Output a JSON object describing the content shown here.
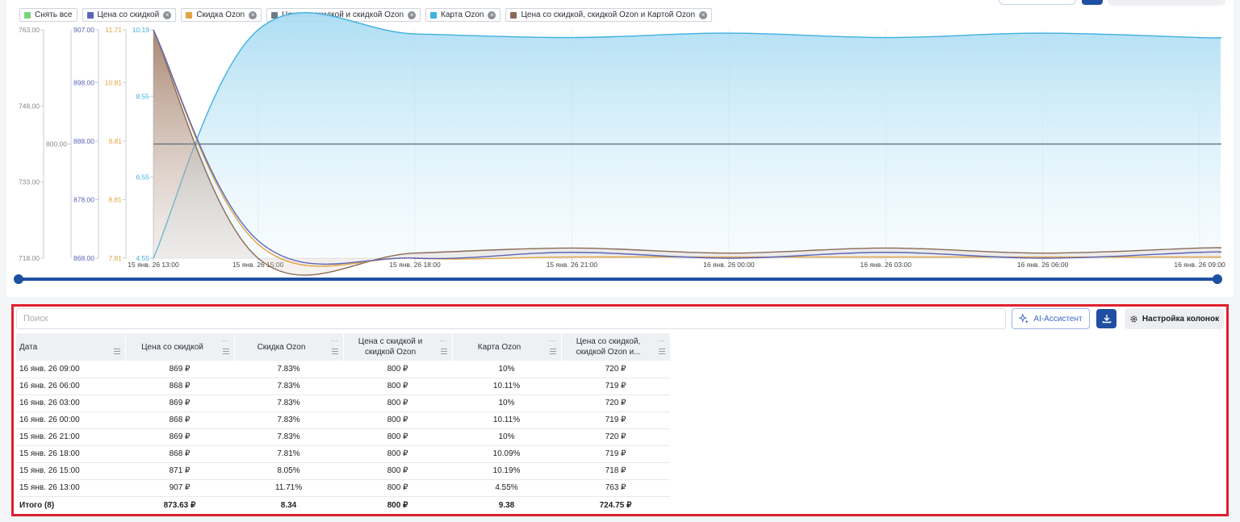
{
  "legend": [
    {
      "label": "Снять все",
      "color": "#7ad37a",
      "closable": false
    },
    {
      "label": "Цена со скидкой",
      "color": "#5b64b8",
      "closable": true
    },
    {
      "label": "Скидка Ozon",
      "color": "#e2a341",
      "closable": true
    },
    {
      "label": "Цена со скидкой и скидкой Ozon",
      "color": "#6d7b84",
      "closable": true
    },
    {
      "label": "Карта Ozon",
      "color": "#3fb0e0",
      "closable": true
    },
    {
      "label": "Цена со скидкой, скидкой Ozon и Картой Ozon",
      "color": "#8a6a58",
      "closable": true
    }
  ],
  "chart_data": {
    "type": "line",
    "x": [
      "15 янв. 26 13:00",
      "15 янв. 26 15:00",
      "15 янв. 26 18:00",
      "15 янв. 26 21:00",
      "16 янв. 26 00:00",
      "16 янв. 26 03:00",
      "16 янв. 26 06:00",
      "16 янв. 26 09:00"
    ],
    "x_tick_labels": [
      "15 янв. 26 13:00",
      "15 янв. 26 15:00",
      "15 янв. 26 18:00",
      "15 янв. 26 21:00",
      "16 янв. 26 00:00",
      "16 янв. 26 03:00",
      "16 янв. 26 06:00",
      "16 янв. 26 09:00"
    ],
    "x_tick_hours": [
      0,
      2,
      5,
      8,
      11,
      14,
      17,
      20
    ],
    "axes": [
      {
        "id": "a1",
        "color": "#888",
        "ticks": [
          "763.00",
          "748.00",
          "733.00",
          "718.00"
        ],
        "min": 718,
        "max": 763
      },
      {
        "id": "a2",
        "color": "#888",
        "ticks": [
          "800.00"
        ],
        "min": 800,
        "max": 800
      },
      {
        "id": "a3",
        "color": "#5b64b8",
        "ticks": [
          "907.00",
          "898.00",
          "888.00",
          "878.00",
          "868.00"
        ],
        "min": 868,
        "max": 907
      },
      {
        "id": "a4",
        "color": "#e2a341",
        "ticks": [
          "11.71",
          "10.81",
          "9.81",
          "8.81",
          "7.81"
        ],
        "min": 7.81,
        "max": 11.71
      },
      {
        "id": "a5",
        "color": "#3fb0e0",
        "ticks": [
          "10.19",
          "8.55",
          "6.55",
          "4.55"
        ],
        "min": 4.55,
        "max": 10.19
      }
    ],
    "series": [
      {
        "name": "Цена со скидкой",
        "color": "#5b64b8",
        "axis": "a3",
        "x": [
          0,
          2,
          5,
          8,
          11,
          14,
          17,
          20
        ],
        "values": [
          907,
          871,
          868,
          869,
          868,
          869,
          868,
          869
        ]
      },
      {
        "name": "Скидка Ozon",
        "color": "#e2a341",
        "axis": "a4",
        "x": [
          0,
          2,
          5,
          8,
          11,
          14,
          17,
          20
        ],
        "values": [
          11.71,
          8.05,
          7.81,
          7.83,
          7.83,
          7.83,
          7.83,
          7.83
        ]
      },
      {
        "name": "Цена со скидкой и скидкой Ozon",
        "color": "#6d7b84",
        "axis": "a2",
        "x": [
          0,
          2,
          5,
          8,
          11,
          14,
          17,
          20
        ],
        "values": [
          800,
          800,
          800,
          800,
          800,
          800,
          800,
          800
        ]
      },
      {
        "name": "Карта Ozon",
        "color": "#3fb0e0",
        "axis": "a5",
        "area": true,
        "x": [
          0,
          2,
          5,
          8,
          11,
          14,
          17,
          20
        ],
        "values": [
          4.55,
          10.19,
          10.09,
          10,
          10.11,
          10,
          10.11,
          10
        ]
      },
      {
        "name": "Цена со скидкой, скидкой Ozon и Картой Ozon",
        "color": "#8a6a58",
        "axis": "a1",
        "area": true,
        "x": [
          0,
          2,
          5,
          8,
          11,
          14,
          17,
          20
        ],
        "values": [
          763,
          718,
          719,
          720,
          719,
          720,
          719,
          720
        ]
      }
    ]
  },
  "table": {
    "search_placeholder": "Поиск",
    "ai_button": "AI-Ассистент",
    "columns_button": "Настройка колонок",
    "columns": [
      "Дата",
      "Цена со скидкой",
      "Скидка Ozon",
      "Цена с скидкой и скидкой Ozon",
      "Карта Ozon",
      "Цена со скидкой, скидкой Ozon и..."
    ],
    "rows": [
      [
        "16 янв. 26 09:00",
        "869 ₽",
        "7.83%",
        "800 ₽",
        "10%",
        "720 ₽"
      ],
      [
        "16 янв. 26 06:00",
        "868 ₽",
        "7.83%",
        "800 ₽",
        "10.11%",
        "719 ₽"
      ],
      [
        "16 янв. 26 03:00",
        "869 ₽",
        "7.83%",
        "800 ₽",
        "10%",
        "720 ₽"
      ],
      [
        "16 янв. 26 00:00",
        "868 ₽",
        "7.83%",
        "800 ₽",
        "10.11%",
        "719 ₽"
      ],
      [
        "15 янв. 26 21:00",
        "869 ₽",
        "7.83%",
        "800 ₽",
        "10%",
        "720 ₽"
      ],
      [
        "15 янв. 26 18:00",
        "868 ₽",
        "7.81%",
        "800 ₽",
        "10.09%",
        "719 ₽"
      ],
      [
        "15 янв. 26 15:00",
        "871 ₽",
        "8.05%",
        "800 ₽",
        "10.19%",
        "718 ₽"
      ],
      [
        "15 янв. 26 13:00",
        "907 ₽",
        "11.71%",
        "800 ₽",
        "4.55%",
        "763 ₽"
      ]
    ],
    "total": [
      "Итого (8)",
      "873.63 ₽",
      "8.34",
      "800 ₽",
      "9.38",
      "724.75 ₽"
    ]
  }
}
